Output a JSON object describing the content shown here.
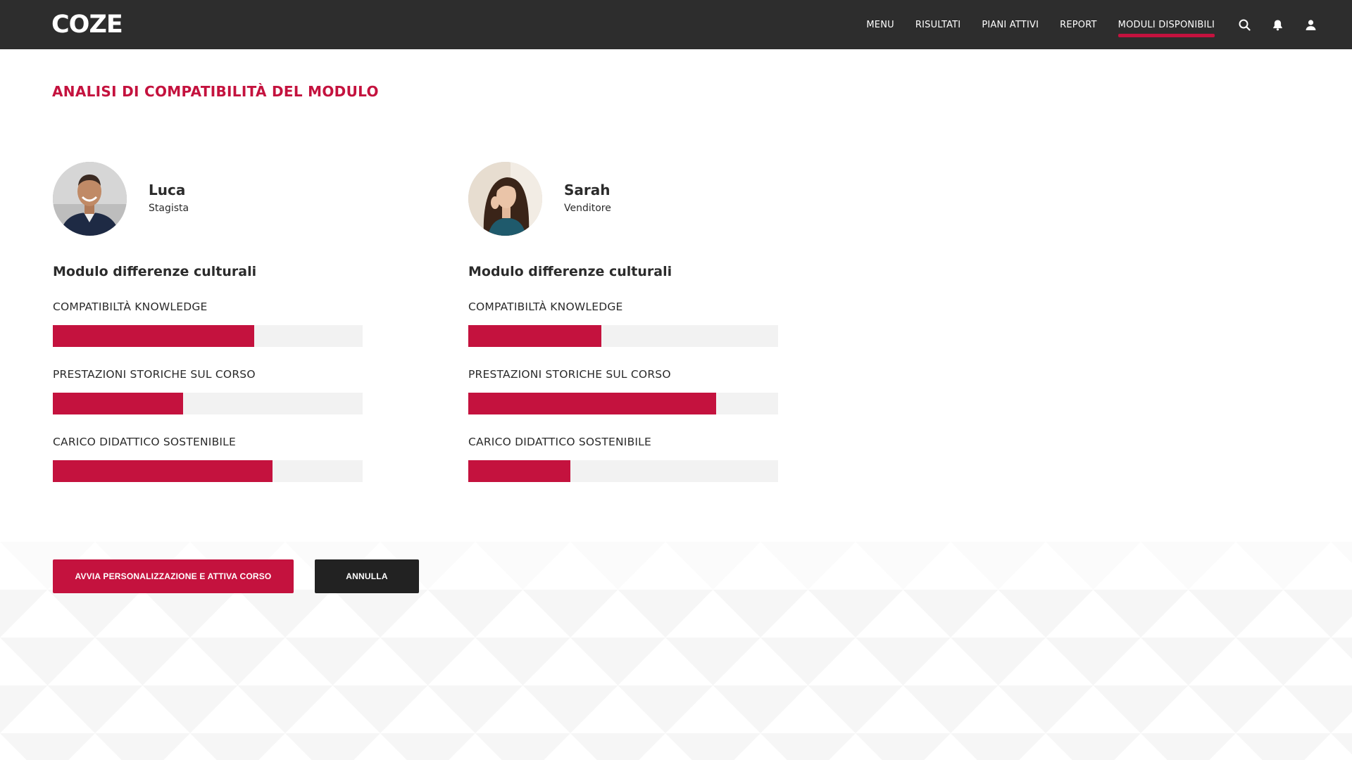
{
  "app": {
    "logo_text": "COZE"
  },
  "nav": {
    "items": [
      {
        "label": "MENU"
      },
      {
        "label": "RISULTATI"
      },
      {
        "label": "PIANI ATTIVI"
      },
      {
        "label": "REPORT"
      },
      {
        "label": "MODULI DISPONIBILI",
        "active": true
      }
    ],
    "icons": [
      "search-icon",
      "bell-icon",
      "user-icon"
    ]
  },
  "page": {
    "title": "ANALISI DI COMPATIBILITÀ DEL MODULO"
  },
  "colors": {
    "accent": "#c4123e",
    "topbar": "#2d2d2d",
    "track": "#f2f2f2",
    "dark_button": "#222222"
  },
  "candidates": [
    {
      "name": "Luca",
      "role": "Stagista",
      "module_title": "Modulo differenze culturali",
      "metrics": [
        {
          "label": "COMPATIBILTÀ KNOWLEDGE",
          "value": 0.65
        },
        {
          "label": "PRESTAZIONI STORICHE SUL CORSO",
          "value": 0.42
        },
        {
          "label": "CARICO DIDATTICO SOSTENIBILE",
          "value": 0.71
        }
      ]
    },
    {
      "name": "Sarah",
      "role": "Venditore",
      "module_title": "Modulo differenze culturali",
      "metrics": [
        {
          "label": "COMPATIBILTÀ KNOWLEDGE",
          "value": 0.43
        },
        {
          "label": "PRESTAZIONI STORICHE SUL CORSO",
          "value": 0.8
        },
        {
          "label": "CARICO DIDATTICO SOSTENIBILE",
          "value": 0.33
        }
      ]
    }
  ],
  "actions": {
    "primary_label": "AVVIA PERSONALIZZAZIONE E ATTIVA CORSO",
    "secondary_label": "ANNULLA"
  }
}
